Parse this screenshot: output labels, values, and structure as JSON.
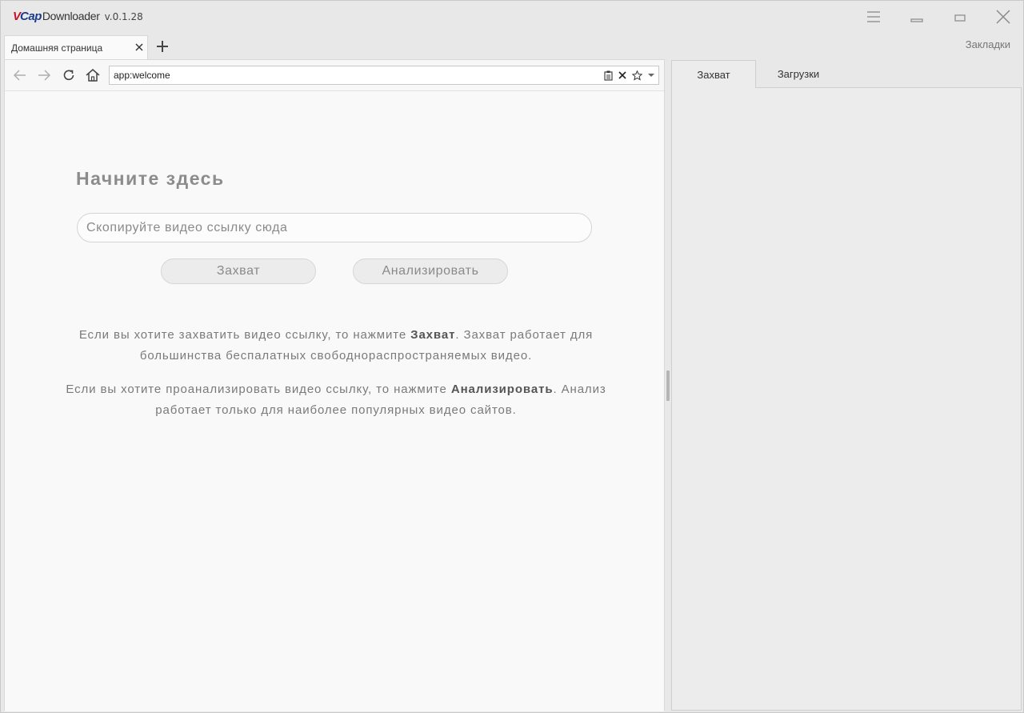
{
  "app": {
    "logo_v": "V",
    "logo_cap": "Cap",
    "logo_rest": "Downloader",
    "version": "v.0.1.28"
  },
  "window_controls": [
    "menu-icon",
    "minimize-icon",
    "maximize-icon",
    "close-icon"
  ],
  "tabs": [
    {
      "label": "Домашняя страница",
      "active": true
    }
  ],
  "bookmarks_label": "Закладки",
  "navbar": {
    "icons": [
      "back-arrow-icon",
      "forward-arrow-icon",
      "reload-icon",
      "home-icon"
    ],
    "url": "app:welcome",
    "url_icons": [
      "clipboard-icon",
      "clear-icon",
      "star-icon",
      "dropdown-icon"
    ]
  },
  "welcome": {
    "title": "Начните здесь",
    "input_placeholder": "Скопируйте видео ссылку сюда",
    "capture_button": "Захват",
    "analyze_button": "Анализировать",
    "info1_pre": "Если вы хотите захватить видео ссылку, то нажмите ",
    "info1_bold": "Захват",
    "info1_post": ". Захват работает для большинства беспалатных свободнораспространяемых видео.",
    "info2_pre": "Если вы хотите проанализировать видео ссылку, то нажмите ",
    "info2_bold": "Анализировать",
    "info2_post": ". Анализ работает только для наиболее популярных видео сайтов."
  },
  "right_panel": {
    "tabs": [
      {
        "label": "Захват",
        "active": true
      },
      {
        "label": "Загрузки",
        "active": false
      }
    ]
  },
  "colors": {
    "logo_red": "#c8102e",
    "logo_blue": "#1b3c8c",
    "background": "#e8e8e8",
    "page": "#f9f9f9"
  }
}
